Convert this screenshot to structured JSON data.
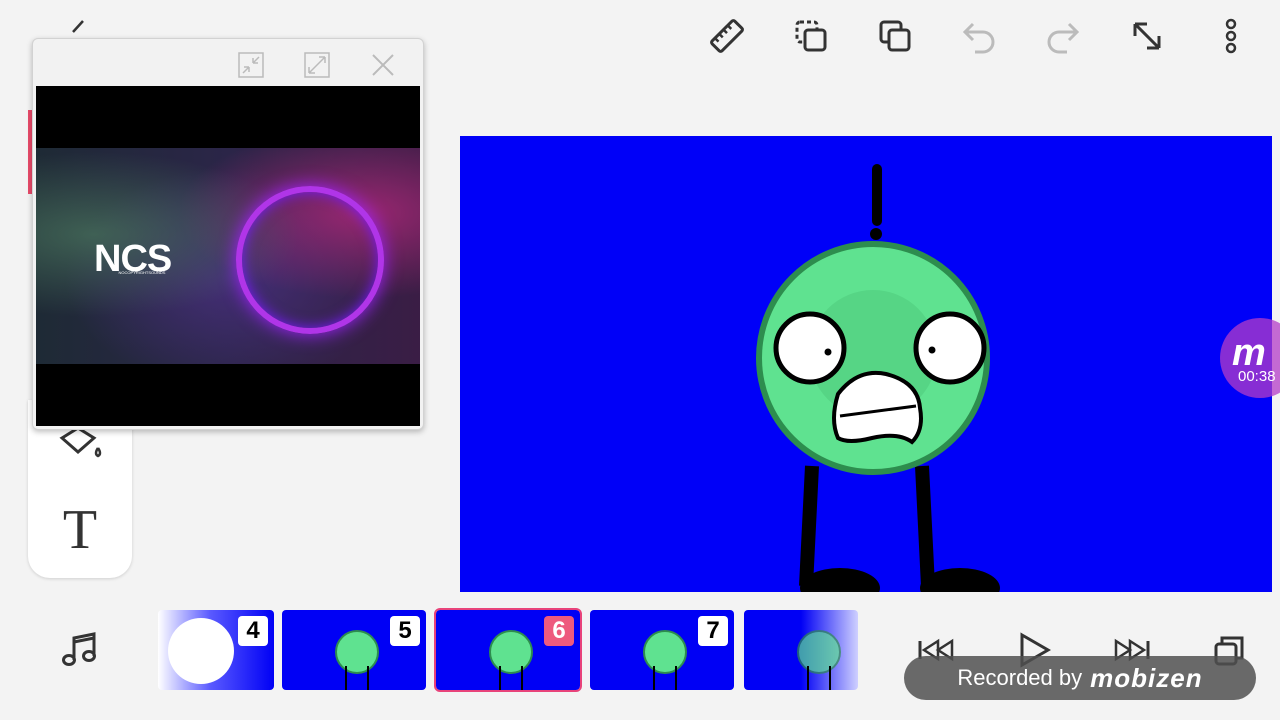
{
  "toolbar": {
    "back": "back-icon",
    "ruler": "ruler-icon",
    "copy_layer": "copy-layer-icon",
    "duplicate": "duplicate-icon",
    "undo": "undo-icon",
    "redo": "redo-icon",
    "expand": "expand-icon",
    "more": "more-icon"
  },
  "popup": {
    "video_title": "NCS",
    "video_subtitle": "NOCOPYRIGHTSOUNDS"
  },
  "left_tools": {
    "text_tool": "T"
  },
  "frames": [
    {
      "number": "4",
      "active": false
    },
    {
      "number": "5",
      "active": false
    },
    {
      "number": "6",
      "active": true
    },
    {
      "number": "7",
      "active": false
    },
    {
      "number": "",
      "active": false
    }
  ],
  "playback": {
    "first": "skip-to-start-icon",
    "play": "play-icon",
    "last": "skip-to-end-icon",
    "layers": "layers-icon"
  },
  "watermark": {
    "prefix": "Recorded by",
    "brand": "mobizen"
  },
  "recorder": {
    "time": "00:38",
    "logo": "m"
  },
  "colors": {
    "canvas_bg": "#0000f8",
    "character": "#5fe290",
    "active_frame": "#ee5a7e"
  }
}
